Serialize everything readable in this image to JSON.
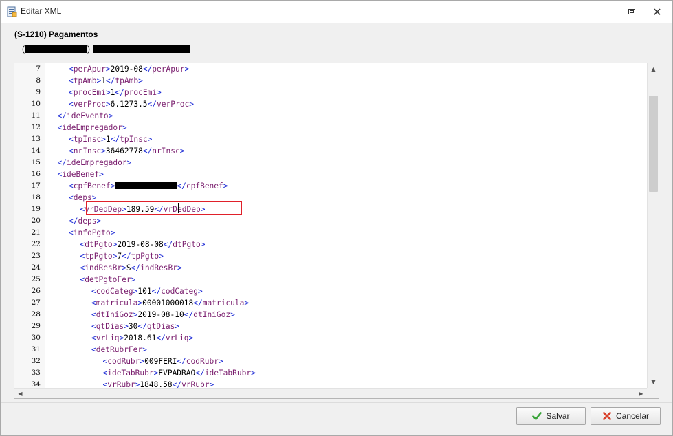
{
  "window": {
    "title": "Editar XML",
    "icon": "xml-document-icon",
    "restore_icon": "restore-window-icon",
    "close_label": "✕"
  },
  "header": {
    "doc_title": "(S-1210) Pagamentos",
    "sub_open": "(",
    "sub_close": ")"
  },
  "editor": {
    "lines": [
      {
        "n": "7",
        "indent": 3,
        "parts": [
          [
            "br",
            "<"
          ],
          [
            "tag",
            "perApur"
          ],
          [
            "br",
            ">"
          ],
          [
            "txt",
            "2019-08"
          ],
          [
            "br",
            "</"
          ],
          [
            "tag",
            "perApur"
          ],
          [
            "br",
            ">"
          ]
        ]
      },
      {
        "n": "8",
        "indent": 3,
        "parts": [
          [
            "br",
            "<"
          ],
          [
            "tag",
            "tpAmb"
          ],
          [
            "br",
            ">"
          ],
          [
            "txt",
            "1"
          ],
          [
            "br",
            "</"
          ],
          [
            "tag",
            "tpAmb"
          ],
          [
            "br",
            ">"
          ]
        ]
      },
      {
        "n": "9",
        "indent": 3,
        "parts": [
          [
            "br",
            "<"
          ],
          [
            "tag",
            "procEmi"
          ],
          [
            "br",
            ">"
          ],
          [
            "txt",
            "1"
          ],
          [
            "br",
            "</"
          ],
          [
            "tag",
            "procEmi"
          ],
          [
            "br",
            ">"
          ]
        ]
      },
      {
        "n": "10",
        "indent": 3,
        "parts": [
          [
            "br",
            "<"
          ],
          [
            "tag",
            "verProc"
          ],
          [
            "br",
            ">"
          ],
          [
            "txt",
            "6.1273.5"
          ],
          [
            "br",
            "</"
          ],
          [
            "tag",
            "verProc"
          ],
          [
            "br",
            ">"
          ]
        ]
      },
      {
        "n": "11",
        "indent": 2,
        "parts": [
          [
            "br",
            "</"
          ],
          [
            "tag",
            "ideEvento"
          ],
          [
            "br",
            ">"
          ]
        ]
      },
      {
        "n": "12",
        "indent": 2,
        "parts": [
          [
            "br",
            "<"
          ],
          [
            "tag",
            "ideEmpregador"
          ],
          [
            "br",
            ">"
          ]
        ]
      },
      {
        "n": "13",
        "indent": 3,
        "parts": [
          [
            "br",
            "<"
          ],
          [
            "tag",
            "tpInsc"
          ],
          [
            "br",
            ">"
          ],
          [
            "txt",
            "1"
          ],
          [
            "br",
            "</"
          ],
          [
            "tag",
            "tpInsc"
          ],
          [
            "br",
            ">"
          ]
        ]
      },
      {
        "n": "14",
        "indent": 3,
        "parts": [
          [
            "br",
            "<"
          ],
          [
            "tag",
            "nrInsc"
          ],
          [
            "br",
            ">"
          ],
          [
            "txt",
            "36462778"
          ],
          [
            "br",
            "</"
          ],
          [
            "tag",
            "nrInsc"
          ],
          [
            "br",
            ">"
          ]
        ]
      },
      {
        "n": "15",
        "indent": 2,
        "parts": [
          [
            "br",
            "</"
          ],
          [
            "tag",
            "ideEmpregador"
          ],
          [
            "br",
            ">"
          ]
        ]
      },
      {
        "n": "16",
        "indent": 2,
        "parts": [
          [
            "br",
            "<"
          ],
          [
            "tag",
            "ideBenef"
          ],
          [
            "br",
            ">"
          ]
        ]
      },
      {
        "n": "17",
        "indent": 3,
        "parts": [
          [
            "br",
            "<"
          ],
          [
            "tag",
            "cpfBenef"
          ],
          [
            "br",
            ">"
          ],
          [
            "redact",
            ""
          ],
          [
            "br",
            "</"
          ],
          [
            "tag",
            "cpfBenef"
          ],
          [
            "br",
            ">"
          ]
        ]
      },
      {
        "n": "18",
        "indent": 3,
        "parts": [
          [
            "br",
            "<"
          ],
          [
            "tag",
            "deps"
          ],
          [
            "br",
            ">"
          ]
        ]
      },
      {
        "n": "19",
        "indent": 4,
        "parts": [
          [
            "br",
            "<"
          ],
          [
            "tag",
            "vrDedDep"
          ],
          [
            "br",
            ">"
          ],
          [
            "txt",
            "189.59"
          ],
          [
            "br",
            "</"
          ],
          [
            "tag",
            "vrDedDep"
          ],
          [
            "br",
            ">"
          ]
        ]
      },
      {
        "n": "20",
        "indent": 3,
        "parts": [
          [
            "br",
            "</"
          ],
          [
            "tag",
            "deps"
          ],
          [
            "br",
            ">"
          ]
        ]
      },
      {
        "n": "21",
        "indent": 3,
        "parts": [
          [
            "br",
            "<"
          ],
          [
            "tag",
            "infoPgto"
          ],
          [
            "br",
            ">"
          ]
        ]
      },
      {
        "n": "22",
        "indent": 4,
        "parts": [
          [
            "br",
            "<"
          ],
          [
            "tag",
            "dtPgto"
          ],
          [
            "br",
            ">"
          ],
          [
            "txt",
            "2019-08-08"
          ],
          [
            "br",
            "</"
          ],
          [
            "tag",
            "dtPgto"
          ],
          [
            "br",
            ">"
          ]
        ]
      },
      {
        "n": "23",
        "indent": 4,
        "parts": [
          [
            "br",
            "<"
          ],
          [
            "tag",
            "tpPgto"
          ],
          [
            "br",
            ">"
          ],
          [
            "txt",
            "7"
          ],
          [
            "br",
            "</"
          ],
          [
            "tag",
            "tpPgto"
          ],
          [
            "br",
            ">"
          ]
        ]
      },
      {
        "n": "24",
        "indent": 4,
        "parts": [
          [
            "br",
            "<"
          ],
          [
            "tag",
            "indResBr"
          ],
          [
            "br",
            ">"
          ],
          [
            "txt",
            "S"
          ],
          [
            "br",
            "</"
          ],
          [
            "tag",
            "indResBr"
          ],
          [
            "br",
            ">"
          ]
        ]
      },
      {
        "n": "25",
        "indent": 4,
        "parts": [
          [
            "br",
            "<"
          ],
          [
            "tag",
            "detPgtoFer"
          ],
          [
            "br",
            ">"
          ]
        ]
      },
      {
        "n": "26",
        "indent": 5,
        "parts": [
          [
            "br",
            "<"
          ],
          [
            "tag",
            "codCateg"
          ],
          [
            "br",
            ">"
          ],
          [
            "txt",
            "101"
          ],
          [
            "br",
            "</"
          ],
          [
            "tag",
            "codCateg"
          ],
          [
            "br",
            ">"
          ]
        ]
      },
      {
        "n": "27",
        "indent": 5,
        "parts": [
          [
            "br",
            "<"
          ],
          [
            "tag",
            "matricula"
          ],
          [
            "br",
            ">"
          ],
          [
            "txt",
            "00001000018"
          ],
          [
            "br",
            "</"
          ],
          [
            "tag",
            "matricula"
          ],
          [
            "br",
            ">"
          ]
        ]
      },
      {
        "n": "28",
        "indent": 5,
        "parts": [
          [
            "br",
            "<"
          ],
          [
            "tag",
            "dtIniGoz"
          ],
          [
            "br",
            ">"
          ],
          [
            "txt",
            "2019-08-10"
          ],
          [
            "br",
            "</"
          ],
          [
            "tag",
            "dtIniGoz"
          ],
          [
            "br",
            ">"
          ]
        ]
      },
      {
        "n": "29",
        "indent": 5,
        "parts": [
          [
            "br",
            "<"
          ],
          [
            "tag",
            "qtDias"
          ],
          [
            "br",
            ">"
          ],
          [
            "txt",
            "30"
          ],
          [
            "br",
            "</"
          ],
          [
            "tag",
            "qtDias"
          ],
          [
            "br",
            ">"
          ]
        ]
      },
      {
        "n": "30",
        "indent": 5,
        "parts": [
          [
            "br",
            "<"
          ],
          [
            "tag",
            "vrLiq"
          ],
          [
            "br",
            ">"
          ],
          [
            "txt",
            "2018.61"
          ],
          [
            "br",
            "</"
          ],
          [
            "tag",
            "vrLiq"
          ],
          [
            "br",
            ">"
          ]
        ]
      },
      {
        "n": "31",
        "indent": 5,
        "parts": [
          [
            "br",
            "<"
          ],
          [
            "tag",
            "detRubrFer"
          ],
          [
            "br",
            ">"
          ]
        ]
      },
      {
        "n": "32",
        "indent": 6,
        "parts": [
          [
            "br",
            "<"
          ],
          [
            "tag",
            "codRubr"
          ],
          [
            "br",
            ">"
          ],
          [
            "txt",
            "009FERI"
          ],
          [
            "br",
            "</"
          ],
          [
            "tag",
            "codRubr"
          ],
          [
            "br",
            ">"
          ]
        ]
      },
      {
        "n": "33",
        "indent": 6,
        "parts": [
          [
            "br",
            "<"
          ],
          [
            "tag",
            "ideTabRubr"
          ],
          [
            "br",
            ">"
          ],
          [
            "txt",
            "EVPADRAO"
          ],
          [
            "br",
            "</"
          ],
          [
            "tag",
            "ideTabRubr"
          ],
          [
            "br",
            ">"
          ]
        ]
      },
      {
        "n": "34",
        "indent": 6,
        "parts": [
          [
            "br",
            "<"
          ],
          [
            "tag",
            "vrRubr"
          ],
          [
            "br",
            ">"
          ],
          [
            "txt",
            "1848.58"
          ],
          [
            "br",
            "</"
          ],
          [
            "tag",
            "vrRubr"
          ],
          [
            "br",
            ">"
          ]
        ]
      }
    ]
  },
  "footer": {
    "save_label": "Salvar",
    "cancel_label": "Cancelar"
  },
  "colors": {
    "tag": "#7a1e6e",
    "bracket": "#1d2bd6",
    "highlight": "#e0202a",
    "save_icon": "#3aa53a",
    "cancel_icon": "#d9412b"
  }
}
